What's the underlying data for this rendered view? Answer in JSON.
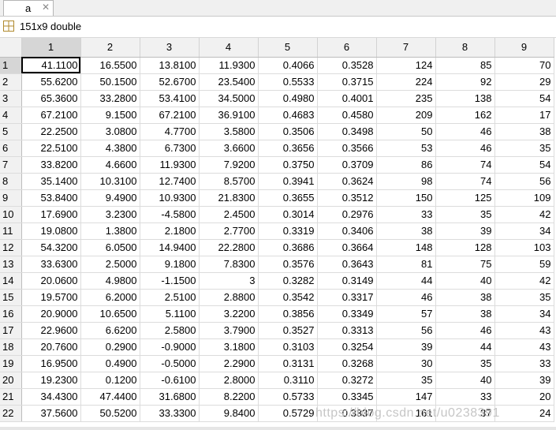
{
  "tab": {
    "name": "a",
    "close_glyph": "✕"
  },
  "info": {
    "text": "151x9 double",
    "icon": "grid-icon"
  },
  "columns": [
    "1",
    "2",
    "3",
    "4",
    "5",
    "6",
    "7",
    "8",
    "9"
  ],
  "rows": [
    {
      "n": "1",
      "c": [
        "41.1100",
        "16.5500",
        "13.8100",
        "11.9300",
        "0.4066",
        "0.3528",
        "124",
        "85",
        "70"
      ]
    },
    {
      "n": "2",
      "c": [
        "55.6200",
        "50.1500",
        "52.6700",
        "23.5400",
        "0.5533",
        "0.3715",
        "224",
        "92",
        "29"
      ]
    },
    {
      "n": "3",
      "c": [
        "65.3600",
        "33.2800",
        "53.4100",
        "34.5000",
        "0.4980",
        "0.4001",
        "235",
        "138",
        "54"
      ]
    },
    {
      "n": "4",
      "c": [
        "67.2100",
        "9.1500",
        "67.2100",
        "36.9100",
        "0.4683",
        "0.4580",
        "209",
        "162",
        "17"
      ]
    },
    {
      "n": "5",
      "c": [
        "22.2500",
        "3.0800",
        "4.7700",
        "3.5800",
        "0.3506",
        "0.3498",
        "50",
        "46",
        "38"
      ]
    },
    {
      "n": "6",
      "c": [
        "22.5100",
        "4.3800",
        "6.7300",
        "3.6600",
        "0.3656",
        "0.3566",
        "53",
        "46",
        "35"
      ]
    },
    {
      "n": "7",
      "c": [
        "33.8200",
        "4.6600",
        "11.9300",
        "7.9200",
        "0.3750",
        "0.3709",
        "86",
        "74",
        "54"
      ]
    },
    {
      "n": "8",
      "c": [
        "35.1400",
        "10.3100",
        "12.7400",
        "8.5700",
        "0.3941",
        "0.3624",
        "98",
        "74",
        "56"
      ]
    },
    {
      "n": "9",
      "c": [
        "53.8400",
        "9.4900",
        "10.9300",
        "21.8300",
        "0.3655",
        "0.3512",
        "150",
        "125",
        "109"
      ]
    },
    {
      "n": "10",
      "c": [
        "17.6900",
        "3.2300",
        "-4.5800",
        "2.4500",
        "0.3014",
        "0.2976",
        "33",
        "35",
        "42"
      ]
    },
    {
      "n": "11",
      "c": [
        "19.0800",
        "1.3800",
        "2.1800",
        "2.7700",
        "0.3319",
        "0.3406",
        "38",
        "39",
        "34"
      ]
    },
    {
      "n": "12",
      "c": [
        "54.3200",
        "6.0500",
        "14.9400",
        "22.2800",
        "0.3686",
        "0.3664",
        "148",
        "128",
        "103"
      ]
    },
    {
      "n": "13",
      "c": [
        "33.6300",
        "2.5000",
        "9.1800",
        "7.8300",
        "0.3576",
        "0.3643",
        "81",
        "75",
        "59"
      ]
    },
    {
      "n": "14",
      "c": [
        "20.0600",
        "4.9800",
        "-1.1500",
        "3",
        "0.3282",
        "0.3149",
        "44",
        "40",
        "42"
      ]
    },
    {
      "n": "15",
      "c": [
        "19.5700",
        "6.2000",
        "2.5100",
        "2.8800",
        "0.3542",
        "0.3317",
        "46",
        "38",
        "35"
      ]
    },
    {
      "n": "16",
      "c": [
        "20.9000",
        "10.6500",
        "5.1100",
        "3.2200",
        "0.3856",
        "0.3349",
        "57",
        "38",
        "34"
      ]
    },
    {
      "n": "17",
      "c": [
        "22.9600",
        "6.6200",
        "2.5800",
        "3.7900",
        "0.3527",
        "0.3313",
        "56",
        "46",
        "43"
      ]
    },
    {
      "n": "18",
      "c": [
        "20.7600",
        "0.2900",
        "-0.9000",
        "3.1800",
        "0.3103",
        "0.3254",
        "39",
        "44",
        "43"
      ]
    },
    {
      "n": "19",
      "c": [
        "16.9500",
        "0.4900",
        "-0.5000",
        "2.2900",
        "0.3131",
        "0.3268",
        "30",
        "35",
        "33"
      ]
    },
    {
      "n": "20",
      "c": [
        "19.2300",
        "0.1200",
        "-0.6100",
        "2.8000",
        "0.3110",
        "0.3272",
        "35",
        "40",
        "39"
      ]
    },
    {
      "n": "21",
      "c": [
        "34.4300",
        "47.4400",
        "31.6800",
        "8.2200",
        "0.5733",
        "0.3345",
        "147",
        "33",
        "20"
      ]
    },
    {
      "n": "22",
      "c": [
        "37.5600",
        "50.5200",
        "33.3300",
        "9.8400",
        "0.5729",
        "0.3337",
        "161",
        "37",
        "24"
      ]
    }
  ],
  "watermark": "https://blog.csdn.net/u0238391"
}
